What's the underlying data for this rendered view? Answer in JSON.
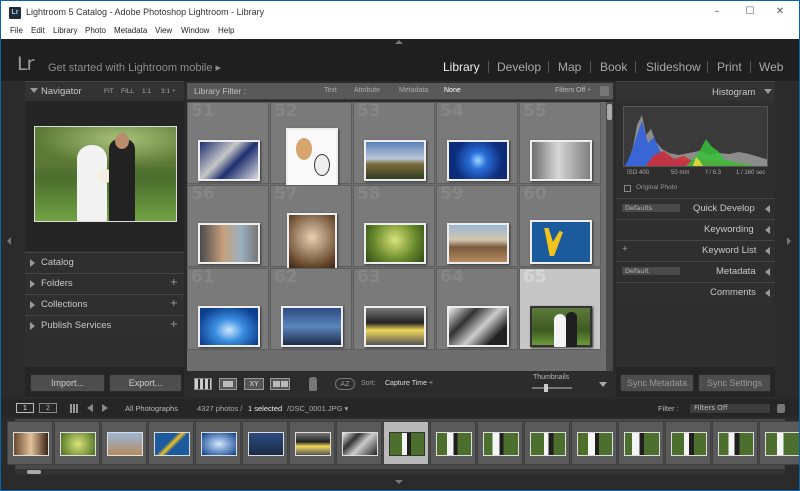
{
  "window": {
    "title": "Lightroom 5 Catalog - Adobe Photoshop Lightroom - Library",
    "app_icon_text": "Lr",
    "controls": {
      "minimize": "–",
      "maximize": "☐",
      "close": "✕"
    }
  },
  "menu": [
    "File",
    "Edit",
    "Library",
    "Photo",
    "Metadata",
    "View",
    "Window",
    "Help"
  ],
  "identity": {
    "logo": "Lr",
    "get_started": "Get started with Lightroom mobile ▸"
  },
  "modules": [
    "Library",
    "Develop",
    "Map",
    "Book",
    "Slideshow",
    "Print",
    "Web"
  ],
  "active_module": "Library",
  "navigator": {
    "title": "Navigator",
    "zoom_options": [
      "FIT",
      "FILL",
      "1:1",
      "3:1 ÷"
    ]
  },
  "left_panels": [
    {
      "label": "Catalog",
      "plus": ""
    },
    {
      "label": "Folders",
      "plus": "+"
    },
    {
      "label": "Collections",
      "plus": "+"
    },
    {
      "label": "Publish Services",
      "plus": "+"
    }
  ],
  "import_label": "Import...",
  "export_label": "Export...",
  "library_filter": {
    "label": "Library Filter :",
    "options": [
      "Text",
      "Attribute",
      "Metadata",
      "None"
    ],
    "selected": "None",
    "filters_off": "Filters Off ÷"
  },
  "grid": {
    "cell_numbers": [
      "51",
      "52",
      "53",
      "54",
      "55",
      "56",
      "57",
      "58",
      "59",
      "60",
      "61",
      "62",
      "63",
      "64",
      "65"
    ],
    "selected_index": 14,
    "colors": {
      "cell_bg": "#7a7a7a",
      "selected_bg": "#c6c6c6"
    }
  },
  "toolbar": {
    "view_icons": [
      "grid-view-icon",
      "loupe-view-icon",
      "compare-view-icon",
      "survey-view-icon"
    ],
    "compare_label": "XY",
    "sort_label": "Sort:",
    "sort_value": "Capture Time ÷",
    "thumbnails_label": "Thumbnails"
  },
  "histogram": {
    "title": "Histogram",
    "iso": "ISO 400",
    "focal": "50 mm",
    "aperture": "f / 6.3",
    "shutter": "1 / 160 sec",
    "original_photo": "Original Photo"
  },
  "right_panels": [
    {
      "label": "Quick Develop",
      "select": "Defaults"
    },
    {
      "label": "Keywording",
      "select": ""
    },
    {
      "label": "Keyword List",
      "select": "",
      "prefix": "+"
    },
    {
      "label": "Metadata",
      "select": "Default"
    },
    {
      "label": "Comments",
      "select": ""
    }
  ],
  "sync_metadata_label": "Sync Metadata",
  "sync_settings_label": "Sync Settings",
  "filmstrip_bar": {
    "monitor1": "1",
    "monitor2": "2",
    "source": "All Photographs",
    "count": "4327 photos /",
    "selected": "1 selected",
    "filename": "/DSC_0001.JPG ▾",
    "filter_label": "Filter :",
    "filter_value": "Filters Off"
  },
  "filmstrip": {
    "count": 17,
    "selected_index": 8
  }
}
